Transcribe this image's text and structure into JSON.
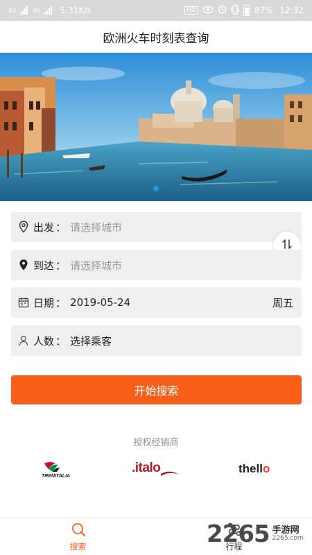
{
  "status_bar": {
    "net_type_1": "4G",
    "net_type_2": "3G",
    "speed": "5.31K/s",
    "battery": "87%",
    "time": "12:32"
  },
  "header": {
    "title": "欧洲火车时刻表查询"
  },
  "banner": {
    "image": "venice-grand-canal",
    "slide_count": 1,
    "active_slide": 1
  },
  "form": {
    "departure": {
      "label": "出发",
      "colon": "：",
      "placeholder": "请选择城市"
    },
    "arrival": {
      "label": "到达",
      "colon": "：",
      "placeholder": "请选择城市"
    },
    "date": {
      "label": "日期",
      "colon": "：",
      "value": "2019-05-24",
      "weekday": "周五"
    },
    "passengers": {
      "label": "人数",
      "colon": "：",
      "value": "选择乘客"
    },
    "swap_icon": "swap-icon"
  },
  "actions": {
    "search_label": "开始搜索",
    "accent_color": "#fa5f19"
  },
  "dealers": {
    "title": "授权经销商",
    "logos": [
      {
        "name": "TRENITALIA",
        "text": "TRENITALIA"
      },
      {
        "name": "italo",
        "text": ".italo"
      },
      {
        "name": "thello",
        "text": "thello"
      }
    ]
  },
  "tabbar": {
    "tabs": [
      {
        "label": "搜索",
        "icon": "search-icon",
        "active": true
      },
      {
        "label": "行程",
        "icon": "route-icon",
        "active": false
      }
    ]
  },
  "watermark": {
    "number": "2265",
    "text": "手游网",
    "url": "2265.com"
  }
}
